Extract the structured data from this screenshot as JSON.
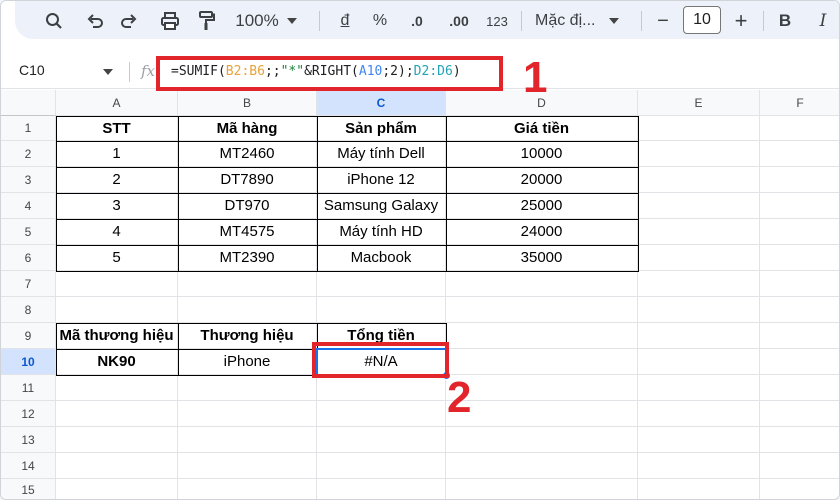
{
  "toolbar": {
    "zoom": "100%",
    "currency": "đ",
    "percent": "%",
    "dec_decrease": ".0",
    "dec_increase": ".00",
    "number_format": "123",
    "font_name": "Mặc đị...",
    "font_size": "10",
    "minus": "−",
    "plus": "+",
    "bold": "B",
    "more": "I"
  },
  "formula_bar": {
    "name_box": "C10",
    "fx": "fx",
    "formula_parts": [
      "=SUMIF(",
      "B2:B6",
      ";;",
      "\"*\"",
      "&RIGHT(",
      "A10",
      ";2);",
      "D2:D6",
      ")"
    ]
  },
  "callouts": {
    "one": "1",
    "two": "2"
  },
  "columns": [
    "A",
    "B",
    "C",
    "D",
    "E",
    "F"
  ],
  "rows": [
    "1",
    "2",
    "3",
    "4",
    "5",
    "6",
    "7",
    "8",
    "9",
    "10",
    "11",
    "12",
    "13",
    "14",
    "15"
  ],
  "table": {
    "headers": [
      "STT",
      "Mã hàng",
      "Sản phẩm",
      "Giá tiền"
    ],
    "rows": [
      [
        "1",
        "MT2460",
        "Máy tính Dell",
        "10000"
      ],
      [
        "2",
        "DT7890",
        "iPhone 12",
        "20000"
      ],
      [
        "3",
        "DT970",
        "Samsung Galaxy",
        "25000"
      ],
      [
        "4",
        "MT4575",
        "Máy tính HD",
        "24000"
      ],
      [
        "5",
        "MT2390",
        "Macbook",
        "35000"
      ]
    ]
  },
  "summary": {
    "headers": [
      "Mã thương hiệu",
      "Thương hiệu",
      "Tổng tiền"
    ],
    "values": [
      "NK90",
      "iPhone",
      "#N/A"
    ]
  },
  "colors": {
    "accent_red": "#e2252b",
    "selection_blue": "#1a73e8"
  }
}
